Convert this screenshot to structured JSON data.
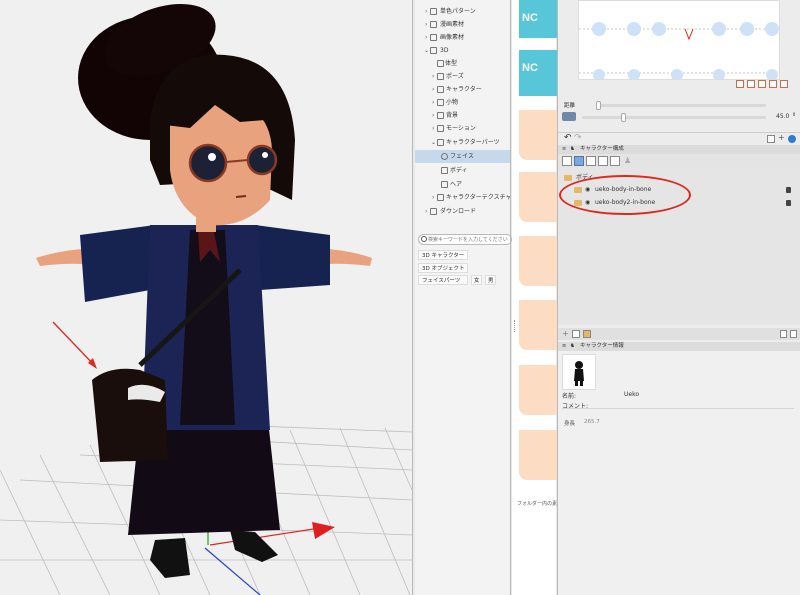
{
  "tree": [
    {
      "label": "単色パターン",
      "expanded": false
    },
    {
      "label": "漫画素材",
      "expanded": false
    },
    {
      "label": "画像素材",
      "expanded": false
    },
    {
      "label": "3D",
      "expanded": true
    },
    {
      "label": "体型",
      "expanded": false
    },
    {
      "label": "ポーズ",
      "expanded": false
    },
    {
      "label": "キャラクター",
      "expanded": false
    },
    {
      "label": "小物",
      "expanded": false
    },
    {
      "label": "背景",
      "expanded": false
    },
    {
      "label": "モーション",
      "expanded": false
    },
    {
      "label": "キャラクターパーツ",
      "expanded": true
    },
    {
      "label": "フェイス",
      "selected": true
    },
    {
      "label": "ボディ"
    },
    {
      "label": "ヘア"
    },
    {
      "label": "キャラクターテクスチャ",
      "expanded": false
    },
    {
      "label": "ダウンロード",
      "expanded": false
    }
  ],
  "search": {
    "placeholder": "検索キーワードを入力してください"
  },
  "tags": {
    "char3d": "3D キャラクター",
    "obj3d": "3D オブジェクト",
    "faceparts": "フェイスパーツ",
    "female": "女",
    "male": "男"
  },
  "thumb_text": "NC",
  "folder_note": "フォルダー内の素",
  "camera": {
    "distance_label": "距離",
    "angle_value": "45.0"
  },
  "char_config": {
    "title": "キャラクター構成",
    "folder": "ボディ",
    "layers": [
      {
        "name": "ueko-body-in-bone"
      },
      {
        "name": "ueko-body2-in-bone"
      }
    ]
  },
  "char_info": {
    "title": "キャラクター情報",
    "name_label": "名前:",
    "name_value": "Ueko",
    "comment_label": "コメント:",
    "height_label": "身長",
    "height_value": "265.7"
  },
  "colors": {
    "accent_red": "#dc2a1e",
    "cyan_thumb": "#56c6d8",
    "skin_thumb": "#fcdcc2",
    "selection": "#c6d9ec"
  }
}
